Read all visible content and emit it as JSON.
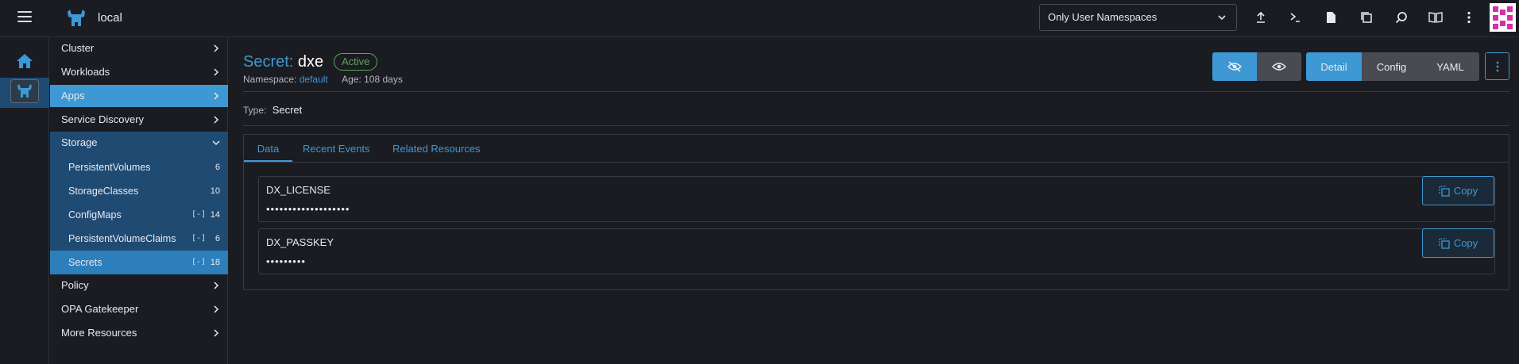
{
  "header": {
    "cluster_name": "local",
    "namespace_filter": "Only User Namespaces",
    "tools": [
      "import-yaml-icon",
      "kubectl-shell-icon",
      "kubeconfig-icon",
      "copy-kubeconfig-icon",
      "search-icon",
      "docs-icon",
      "more-vertical-icon"
    ]
  },
  "sidebar": {
    "items": [
      {
        "label": "Cluster"
      },
      {
        "label": "Workloads"
      },
      {
        "label": "Apps"
      },
      {
        "label": "Service Discovery"
      },
      {
        "label": "Storage"
      },
      {
        "label": "Policy"
      },
      {
        "label": "OPA Gatekeeper"
      },
      {
        "label": "More Resources"
      }
    ],
    "storage_children": [
      {
        "label": "PersistentVolumes",
        "count": "6"
      },
      {
        "label": "StorageClasses",
        "count": "10"
      },
      {
        "label": "ConfigMaps",
        "count": "14"
      },
      {
        "label": "PersistentVolumeClaims",
        "count": "6"
      },
      {
        "label": "Secrets",
        "count": "18"
      }
    ]
  },
  "page": {
    "kind": "Secret:",
    "name": "dxe",
    "state": "Active",
    "namespace_label": "Namespace:",
    "namespace_value": "default",
    "age": "Age: 108 days",
    "type_label": "Type:",
    "type_value": "Secret",
    "view_modes": [
      "Detail",
      "Config",
      "YAML"
    ]
  },
  "tabs": [
    "Data",
    "Recent Events",
    "Related Resources"
  ],
  "secrets": [
    {
      "key": "DX_LICENSE",
      "value": "•••••••••••••••••••",
      "copy_label": "Copy"
    },
    {
      "key": "DX_PASSKEY",
      "value": "•••••••••",
      "copy_label": "Copy"
    }
  ],
  "colors": {
    "accent": "#3d98d3",
    "active_badge": "#5aa55a",
    "background": "#1b1c21",
    "nav_selected": "#1f4b73"
  }
}
